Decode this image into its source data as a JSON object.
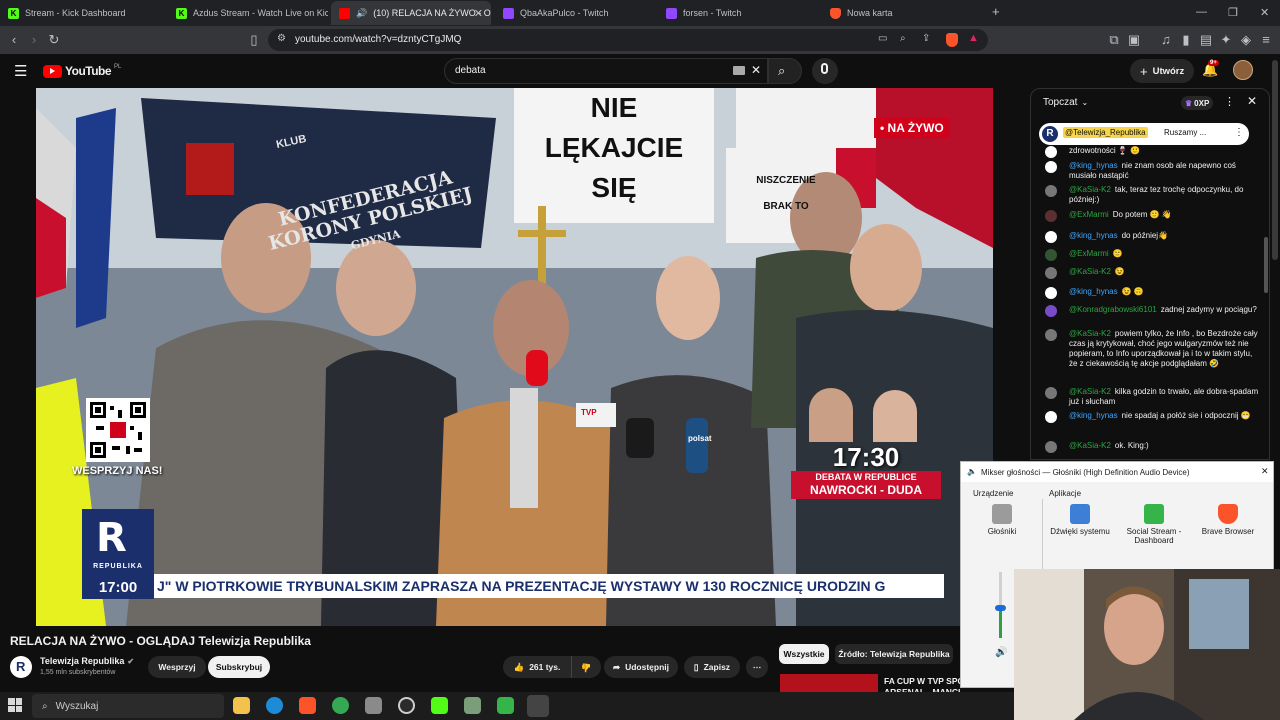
{
  "browser": {
    "tabs": [
      {
        "label": "Stream - Kick Dashboard",
        "icon": "kick-icon",
        "color": "#53fc18",
        "active": false
      },
      {
        "label": "Azdus Stream - Watch Live on Kick",
        "icon": "kick-icon",
        "color": "#53fc18",
        "active": false
      },
      {
        "label": "(10) RELACJA NA ŻYWO - OG",
        "icon": "youtube-icon",
        "color": "#ff0000",
        "active": true
      },
      {
        "label": "QbaAkaPulco - Twitch",
        "icon": "twitch-icon",
        "color": "#9146ff",
        "active": false
      },
      {
        "label": "forsen - Twitch",
        "icon": "twitch-icon",
        "color": "#9146ff",
        "active": false
      },
      {
        "label": "Nowa karta",
        "icon": "brave-icon",
        "color": "#fb542b",
        "active": false
      }
    ],
    "new_tab_symbol": "+",
    "url": "youtube.com/watch?v=dzntyCTgJMQ"
  },
  "youtube": {
    "logo_text": "YouTube",
    "region": "PL",
    "search_value": "debata",
    "create_label": "Utwórz",
    "notifications_badge": "9+"
  },
  "video_overlay": {
    "live_badge": "• NA ŻYWO",
    "qr_caption": "WESPRZYJ NAS!",
    "channel_logo": "REPUBLIKA",
    "clock": "17:00",
    "ticker": "J\" W PIOTRKOWIE TRYBUNALSKIM ZAPRASZA NA PREZENTACJĘ WYSTAWY W 130 ROCZNICĘ URODZIN G",
    "debate_time": "17:30",
    "debate_line1": "DEBATA W REPUBLICE",
    "debate_line2": "NAWROCKI - DUDA",
    "sign_1": "NIE",
    "sign_2": "LĘKAJCIE",
    "sign_3": "SIĘ",
    "banner_text_1": "KONFEDERACJA",
    "banner_text_2": "KORONY POLSKIEJ",
    "banner_text_3": "GDYNIA",
    "banner_club": "KLUB",
    "sign_right_1": "NISZCZENIE",
    "sign_right_2": "BRAK TO",
    "mic_tag_1": "TVP",
    "mic_tag_2": "polsat"
  },
  "chat": {
    "header_label": "Topczat",
    "points_label": "0XP",
    "pinned_author": "@Telewizja_Republika",
    "pinned_text": "Ruszamy ...",
    "messages": [
      {
        "author": "",
        "text": "zdrowotności 🍷 🙂",
        "style": "kg"
      },
      {
        "author": "@king_hynas",
        "text": "nie znam osob ale napewno coś musiało nastąpić",
        "style": "kg"
      },
      {
        "author": "@KaSia-K2",
        "text": "tak, teraz tez trochę odpoczynku, do później:)",
        "style": "g"
      },
      {
        "author": "@ExMarmi",
        "text": "Do potem 🙂 👋",
        "style": "g"
      },
      {
        "author": "@king_hynas",
        "text": "do później👋",
        "style": "kg"
      },
      {
        "author": "@ExMarmi",
        "text": "🙂",
        "style": "g"
      },
      {
        "author": "@KaSia-K2",
        "text": "😉",
        "style": "g"
      },
      {
        "author": "@king_hynas",
        "text": "😉 🙃",
        "style": "kg"
      },
      {
        "author": "@Konradgrabowski6101",
        "text": "zadnej zadymy w pociągu?",
        "style": "g"
      },
      {
        "author": "@KaSia-K2",
        "text": "powiem tylko, że Info , bo Bezdroże cały czas ją krytykował, choć jego wulgaryzmów też nie popieram, to Info uporządkował ja i to w takim stylu, że z ciekawością tę akcje podglądałam 🤣",
        "style": "g"
      },
      {
        "author": "@KaSia-K2",
        "text": "kilka godzin to trwało, ale dobra-spadam już i słucham",
        "style": "g"
      },
      {
        "author": "@king_hynas",
        "text": "nie spadaj a połóż sie i odpocznij 😁",
        "style": "kg"
      },
      {
        "author": "@KaSia-K2",
        "text": "ok. King:)",
        "style": "g"
      }
    ]
  },
  "mixer": {
    "title": "Mikser głośności — Głośniki (High Definition Audio Device)",
    "device_label": "Urządzenie",
    "apps_label": "Aplikacje",
    "columns": [
      {
        "label": "Głośniki"
      },
      {
        "label": "Dźwięki systemu"
      },
      {
        "label": "Social Stream - Dashboard"
      },
      {
        "label": "Brave Browser"
      }
    ],
    "volume_level": 0.45
  },
  "video_info": {
    "title": "RELACJA NA ŻYWO - OGLĄDAJ Telewizja Republika",
    "channel_name": "Telewizja Republika",
    "subscribers": "1,55 mln subskrybentów",
    "support_label": "Wesprzyj",
    "subscribe_label": "Subskrybuj",
    "likes": "261 tys.",
    "share_label": "Udostępnij",
    "save_label": "Zapisz",
    "chip_all": "Wszystkie",
    "chip_source": "Źródło: Telewizja Republika",
    "related_title_1": "FA CUP W TVP SPO",
    "related_title_2": "ARSENAL - MANCHESTER"
  },
  "taskbar": {
    "search_label": "Wyszukaj"
  },
  "colors": {
    "youtube_red": "#ff0000",
    "republika_red": "#d0021b",
    "chat_green": "#2ba640",
    "chat_blue": "#3ea6ff"
  }
}
